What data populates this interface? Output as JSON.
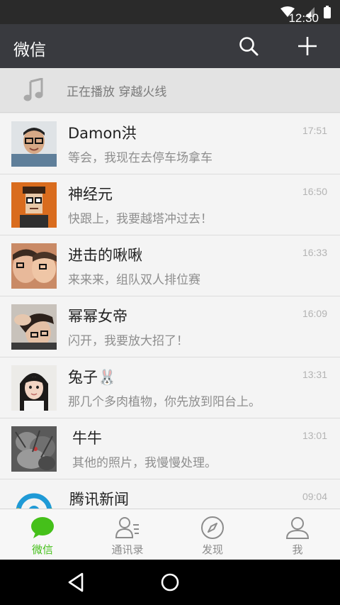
{
  "status_bar": {
    "time": "12:30",
    "icons": [
      "wifi-icon",
      "signal-icon",
      "battery-icon"
    ]
  },
  "app_bar": {
    "title": "微信",
    "actions": [
      "search-icon",
      "plus-icon"
    ]
  },
  "now_playing": {
    "icon": "music-note-icon",
    "text": "正在播放  穿越火线"
  },
  "chats": [
    {
      "name": "Damon洪",
      "preview": "等会，我现在去停车场拿车",
      "time": "17:51"
    },
    {
      "name": "神经元",
      "preview": "快跟上，我要越塔冲过去！",
      "time": "16:50"
    },
    {
      "name": "进击的啾啾",
      "preview": "来来来，组队双人排位赛",
      "time": "16:33"
    },
    {
      "name": "幂幂女帝",
      "preview": "闪开，我要放大招了！",
      "time": "16:09"
    },
    {
      "name": "兔子🐰",
      "preview": "那几个多肉植物，你先放到阳台上。",
      "time": "13:31"
    },
    {
      "name": "牛牛",
      "preview": "其他的照片，我慢慢处理。",
      "time": "13:01"
    },
    {
      "name": "腾讯新闻",
      "preview": "",
      "time": "09:04"
    }
  ],
  "tabs": [
    {
      "label": "微信",
      "icon": "chat-bubble-icon",
      "active": true
    },
    {
      "label": "通讯录",
      "icon": "contacts-icon",
      "active": false
    },
    {
      "label": "发现",
      "icon": "compass-icon",
      "active": false
    },
    {
      "label": "我",
      "icon": "person-icon",
      "active": false
    }
  ],
  "nav_bar": {
    "buttons": [
      "back-icon",
      "home-icon",
      "recents-icon"
    ]
  },
  "colors": {
    "accent": "#45c01a",
    "app_bar": "#393a3f",
    "status_bar": "#2a2a2a"
  }
}
